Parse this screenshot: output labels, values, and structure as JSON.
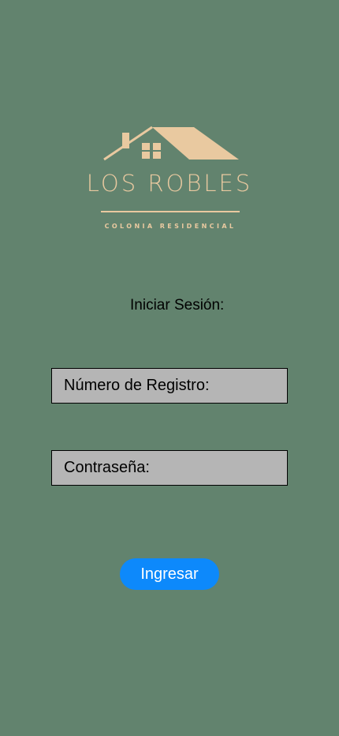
{
  "brand": {
    "name": "LOS ROBLES",
    "subtitle": "COLONIA RESIDENCIAL",
    "logo_icon": "house-roof-icon",
    "color": "#e9c9a0"
  },
  "login": {
    "title": "Iniciar Sesión:",
    "registro_placeholder": "Número de Registro:",
    "password_placeholder": "Contraseña:",
    "submit_label": "Ingresar"
  },
  "colors": {
    "background": "#62836e",
    "field_background": "#b5b5b5",
    "button": "#0d89fb"
  }
}
